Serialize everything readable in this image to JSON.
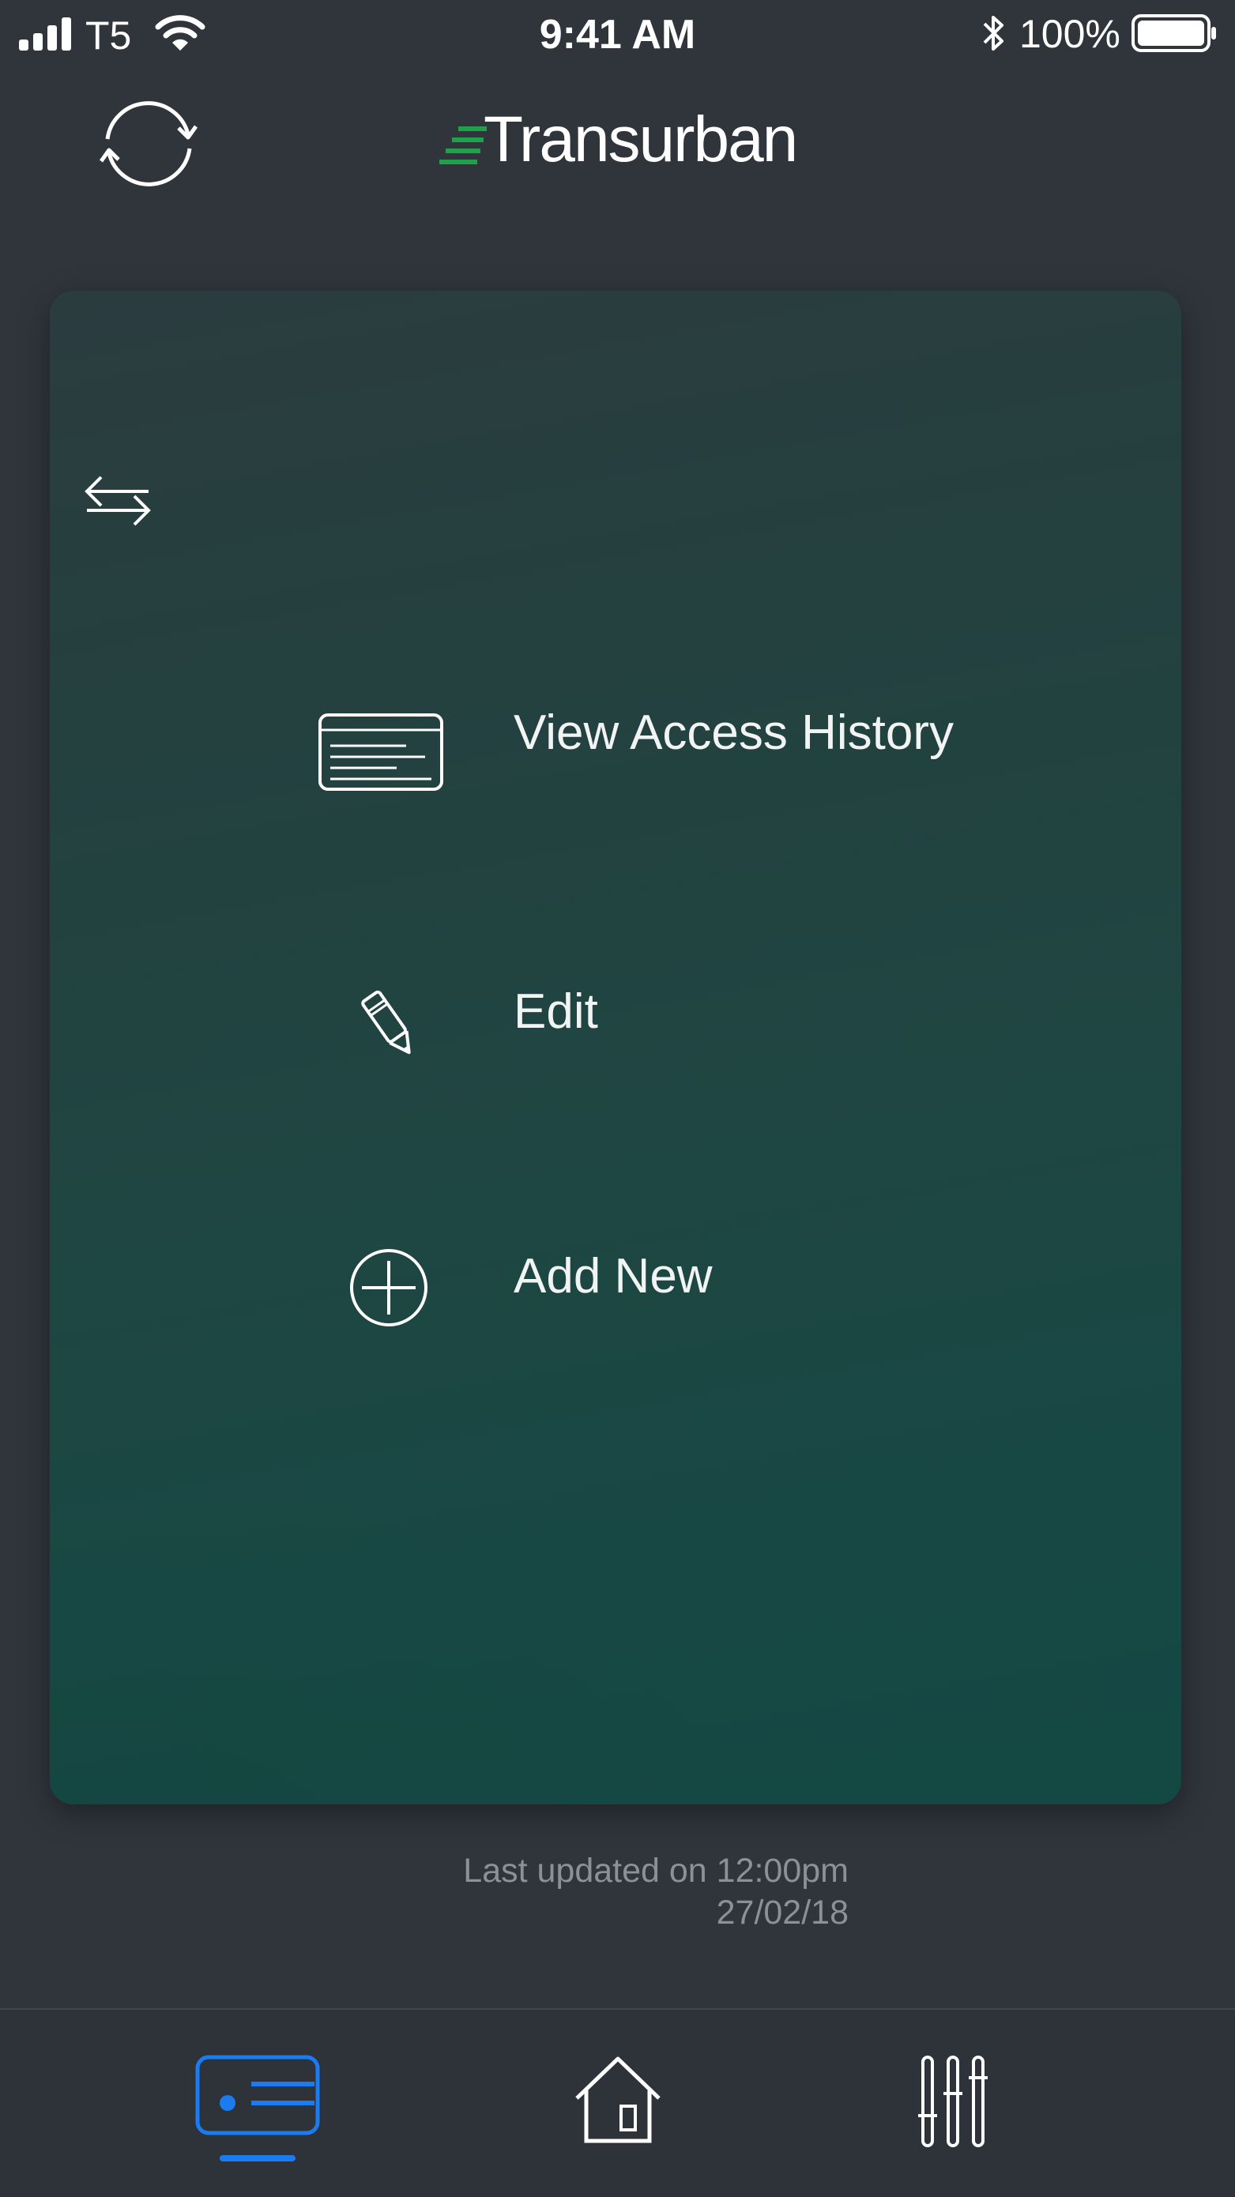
{
  "status_bar": {
    "carrier": "T5",
    "time": "9:41 AM",
    "battery_percent": "100%",
    "icons": [
      "signal-icon",
      "wifi-icon",
      "bluetooth-icon",
      "battery-icon"
    ]
  },
  "header": {
    "brand": "Transurban",
    "brand_accent_color": "#1fa04a",
    "refresh_icon": "refresh-icon"
  },
  "card": {
    "swap_icon": "swap-arrows-icon",
    "menu": [
      {
        "label": "View Access History",
        "icon": "access-history-icon"
      },
      {
        "label": "Edit",
        "icon": "pencil-icon"
      },
      {
        "label": "Add New",
        "icon": "plus-circle-icon"
      }
    ]
  },
  "last_updated": {
    "line1": "Last updated on 12:00pm",
    "line2": "27/02/18"
  },
  "tab_bar": {
    "active_color": "#1a7cf0",
    "tabs": [
      {
        "icon": "card-icon",
        "active": true
      },
      {
        "icon": "home-icon",
        "active": false
      },
      {
        "icon": "settings-sliders-icon",
        "active": false
      }
    ]
  }
}
